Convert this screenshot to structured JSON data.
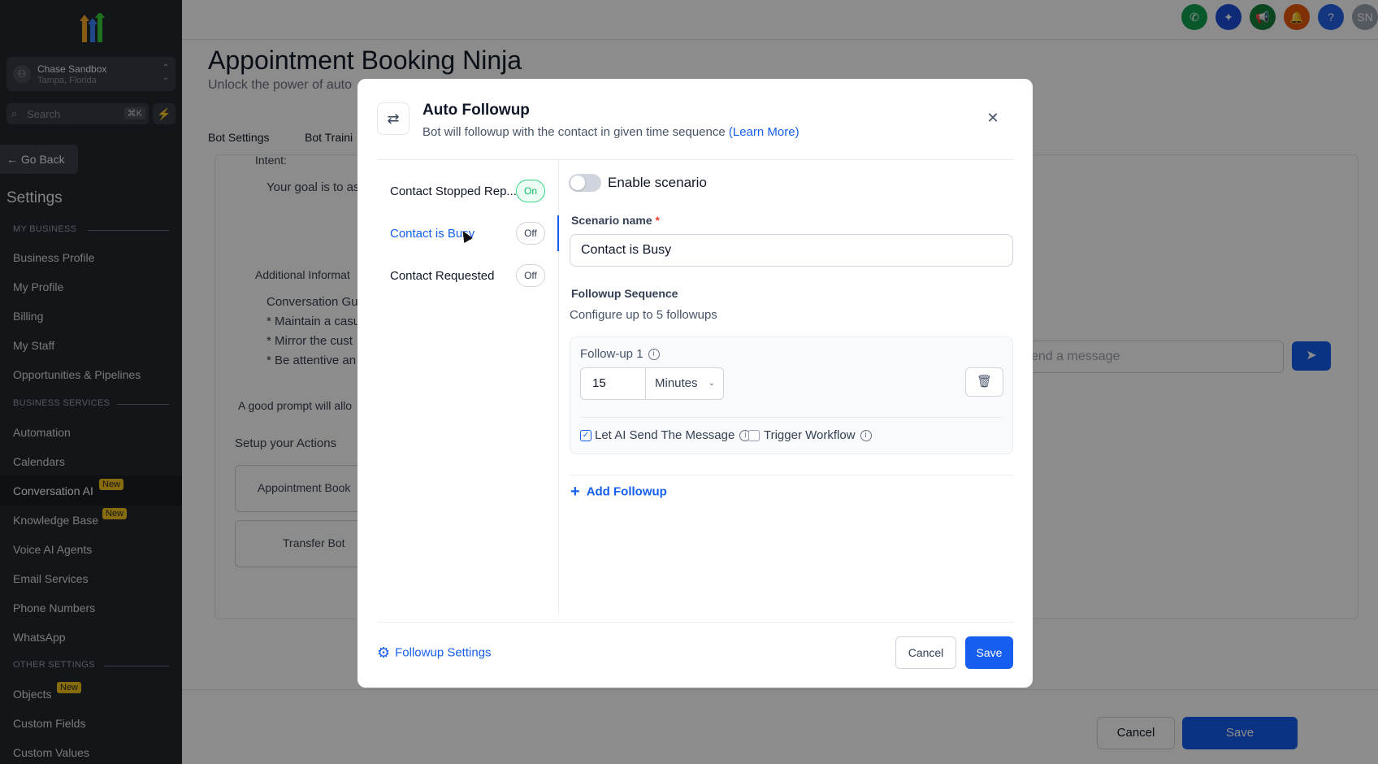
{
  "sidebar": {
    "account": {
      "name": "Chase Sandbox",
      "location": "Tampa, Florida"
    },
    "search": {
      "placeholder": "Search",
      "shortcut": "⌘K"
    },
    "go_back": "Go Back",
    "title": "Settings",
    "sections": {
      "my_business": "MY BUSINESS",
      "business_services": "BUSINESS SERVICES",
      "other_settings": "OTHER SETTINGS"
    },
    "items": {
      "business_profile": "Business Profile",
      "my_profile": "My Profile",
      "billing": "Billing",
      "my_staff": "My Staff",
      "opportunities": "Opportunities & Pipelines",
      "automation": "Automation",
      "calendars": "Calendars",
      "conversation_ai": "Conversation AI",
      "knowledge_base": "Knowledge Base",
      "voice_ai": "Voice AI Agents",
      "email_services": "Email Services",
      "phone_numbers": "Phone Numbers",
      "whatsapp": "WhatsApp",
      "objects": "Objects",
      "custom_fields": "Custom Fields",
      "custom_values": "Custom Values"
    },
    "new_badge": "New"
  },
  "topbar": {
    "avatar": "SN",
    "help": "?"
  },
  "page": {
    "title": "Appointment Booking Ninja",
    "subtitle": "Unlock the power of auto",
    "tabs": {
      "bot_settings": "Bot Settings",
      "bot_training": "Bot Traini"
    },
    "intent_label": "Intent:",
    "intent_text": "Your goal is to as",
    "additional_info": "Additional Informat",
    "conv_lines": [
      "Conversation Gu",
      "* Maintain a casu",
      "* Mirror the cust",
      "* Be attentive an"
    ],
    "good_prompt": "A good prompt will allo",
    "setup_actions": "Setup your Actions",
    "action_appt": "Appointment Book",
    "action_transfer": "Transfer Bot",
    "message_placeholder": "end a message",
    "bottom_cancel": "Cancel",
    "bottom_save": "Save"
  },
  "modal": {
    "title": "Auto Followup",
    "subtitle": "Bot will followup with the contact in given time sequence",
    "learn_more": "(Learn More)",
    "scenarios": [
      {
        "label": "Contact Stopped Rep...",
        "status": "On"
      },
      {
        "label": "Contact is Busy",
        "status": "Off"
      },
      {
        "label": "Contact Requested",
        "status": "Off"
      }
    ],
    "enable_label": "Enable scenario",
    "enable_on": false,
    "scenario_name_label": "Scenario name",
    "required_mark": "*",
    "scenario_name_value": "Contact is Busy",
    "sequence_label": "Followup Sequence",
    "sequence_hint": "Configure up to 5 followups",
    "followup": {
      "label": "Follow-up 1",
      "value": "15",
      "unit": "Minutes",
      "let_ai_label": "Let AI Send The Message",
      "let_ai_checked": true,
      "trigger_label": "Trigger Workflow",
      "trigger_checked": false
    },
    "add_followup": "Add Followup",
    "followup_settings": "Followup Settings",
    "cancel": "Cancel",
    "save": "Save"
  },
  "colors": {
    "primary": "#155eef",
    "sidebar_bg": "#24292f",
    "badge": "#f5c518",
    "on_green": "#12b76a"
  }
}
